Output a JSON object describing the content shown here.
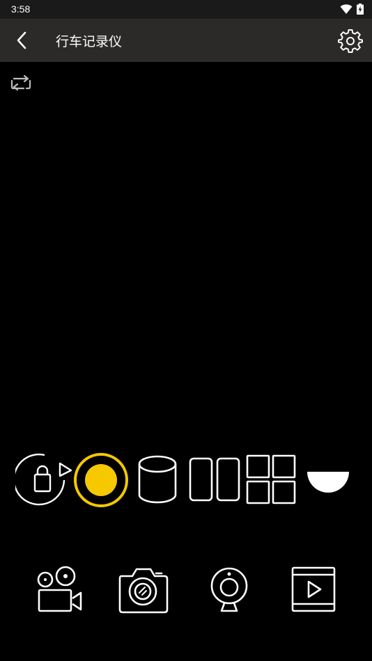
{
  "status_bar": {
    "time": "3:58",
    "icons": [
      "wifi-icon",
      "battery-charging-icon"
    ]
  },
  "toolbar": {
    "title": "行车记录仪",
    "back_icon": "chevron-left-icon",
    "settings_icon": "gear-icon"
  },
  "preview": {
    "rotate_icon": "rotate-view-icon"
  },
  "modes": [
    {
      "name": "lock-rotate",
      "icon": "lock-rotate-icon"
    },
    {
      "name": "record",
      "icon": "record-icon",
      "active": true
    },
    {
      "name": "cylinder-view",
      "icon": "cylinder-icon"
    },
    {
      "name": "dual-split-view",
      "icon": "two-panel-icon"
    },
    {
      "name": "quad-split-view",
      "icon": "four-panel-icon"
    },
    {
      "name": "dome-view",
      "icon": "half-dome-icon"
    }
  ],
  "functions": [
    {
      "name": "video",
      "icon": "video-camera-icon"
    },
    {
      "name": "photo",
      "icon": "photo-camera-icon"
    },
    {
      "name": "webcam",
      "icon": "webcam-icon"
    },
    {
      "name": "playback",
      "icon": "playback-icon"
    }
  ],
  "colors": {
    "accent": "#f5c800",
    "toolbar": "#2b2a29",
    "background": "#000000"
  }
}
